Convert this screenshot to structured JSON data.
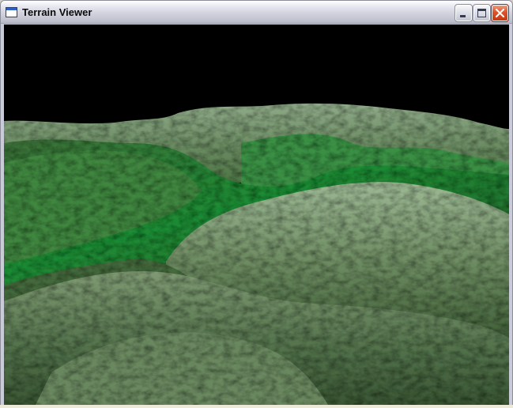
{
  "window": {
    "title": "Terrain Viewer",
    "icon": "application-window-icon",
    "controls": {
      "minimize": "minimize-icon",
      "maximize": "maximize-icon",
      "close": "close-icon"
    }
  },
  "viewport": {
    "scene": "3d-terrain-render",
    "sky_color": "#000000",
    "terrain_colors": {
      "dark": "#2b4a24",
      "mid": "#4f7a45",
      "bright": "#2f9a3e",
      "highlight": "#a9c0a0"
    }
  },
  "colors": {
    "frame": "#c9cbd8",
    "close_button": "#d9532d"
  }
}
